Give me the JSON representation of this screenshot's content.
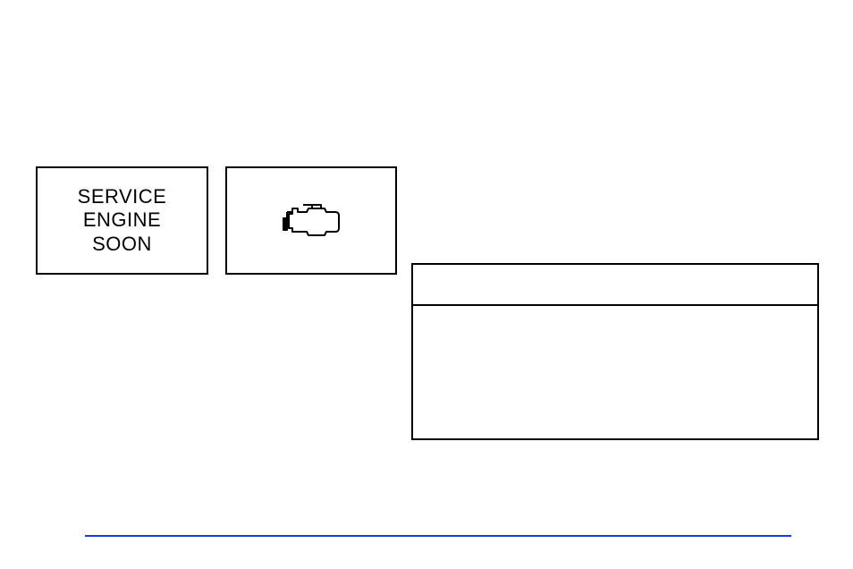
{
  "indicators": {
    "serviceEngineSoon": {
      "line1": "SERVICE",
      "line2": "ENGINE",
      "line3": "SOON"
    },
    "engineIcon": "engine-icon"
  },
  "contentBox": {
    "header": "",
    "body": ""
  }
}
